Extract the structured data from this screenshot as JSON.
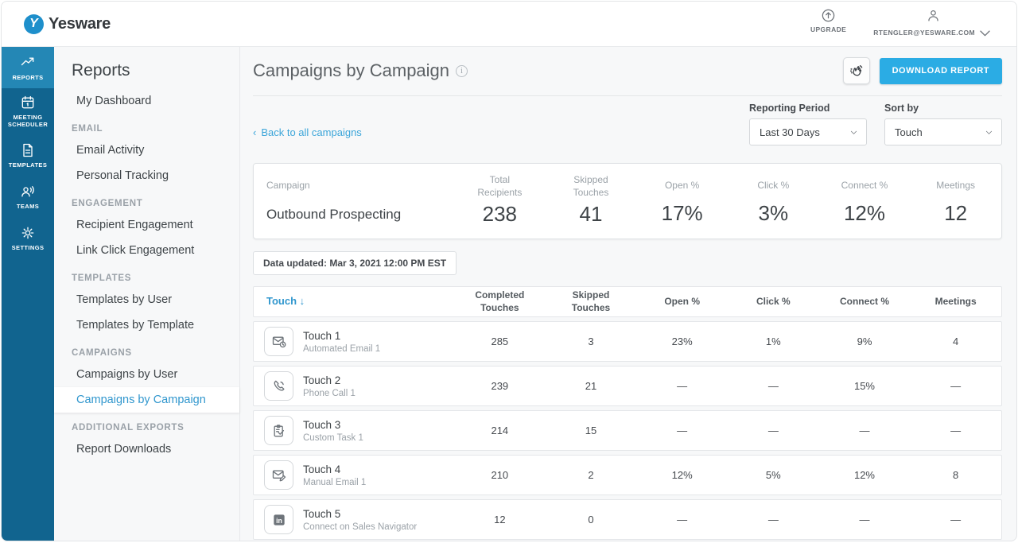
{
  "colors": {
    "accent_blue": "#2bace4",
    "link_blue": "#3ba5d9",
    "rail_blue": "#11648f",
    "rail_active_blue": "#2487b5"
  },
  "topbar": {
    "brand": "Yesware",
    "brand_initial": "Y",
    "upgrade_label": "UPGRADE",
    "account_email": "RTENGLER@YESWARE.COM"
  },
  "rail": {
    "items": [
      {
        "label": "REPORTS"
      },
      {
        "label": "MEETING SCHEDULER"
      },
      {
        "label": "TEMPLATES"
      },
      {
        "label": "TEAMS"
      },
      {
        "label": "SETTINGS"
      }
    ]
  },
  "sidebar": {
    "title": "Reports",
    "entries": [
      {
        "label": "My Dashboard"
      },
      {
        "label": "EMAIL"
      },
      {
        "label": "Email Activity"
      },
      {
        "label": "Personal Tracking"
      },
      {
        "label": "ENGAGEMENT"
      },
      {
        "label": "Recipient Engagement"
      },
      {
        "label": "Link Click Engagement"
      },
      {
        "label": "TEMPLATES"
      },
      {
        "label": "Templates by User"
      },
      {
        "label": "Templates by Template"
      },
      {
        "label": "CAMPAIGNS"
      },
      {
        "label": "Campaigns by User"
      },
      {
        "label": "Campaigns by Campaign"
      },
      {
        "label": "ADDITIONAL EXPORTS"
      },
      {
        "label": "Report Downloads"
      }
    ]
  },
  "main": {
    "title": "Campaigns by Campaign",
    "download_label": "DOWNLOAD REPORT",
    "back_chevron": "‹",
    "back_label": "Back to all campaigns",
    "filters": {
      "reporting_period": {
        "label": "Reporting Period",
        "value": "Last 30 Days"
      },
      "sort_by": {
        "label": "Sort by",
        "value": "Touch"
      }
    },
    "summary": {
      "headers": [
        "Campaign",
        "Total Recipients",
        "Skipped Touches",
        "Open %",
        "Click %",
        "Connect %",
        "Meetings"
      ],
      "campaign_name": "Outbound Prospecting",
      "values": [
        "238",
        "41",
        "17%",
        "3%",
        "12%",
        "12"
      ]
    },
    "data_updated": "Data updated: Mar 3, 2021 12:00 PM EST",
    "table": {
      "sort_label": "Touch",
      "sort_arrow": "↓",
      "headers": [
        "Completed Touches",
        "Skipped Touches",
        "Open %",
        "Click %",
        "Connect %",
        "Meetings"
      ],
      "rows": [
        {
          "icon": "automated-email",
          "title": "Touch 1",
          "subtitle": "Automated Email 1",
          "values": [
            "285",
            "3",
            "23%",
            "1%",
            "9%",
            "4"
          ]
        },
        {
          "icon": "phone-call",
          "title": "Touch 2",
          "subtitle": "Phone Call 1",
          "values": [
            "239",
            "21",
            "—",
            "—",
            "15%",
            "—"
          ]
        },
        {
          "icon": "custom-task",
          "title": "Touch 3",
          "subtitle": "Custom Task 1",
          "values": [
            "214",
            "15",
            "—",
            "—",
            "—",
            "—"
          ]
        },
        {
          "icon": "manual-email",
          "title": "Touch 4",
          "subtitle": "Manual Email 1",
          "values": [
            "210",
            "2",
            "12%",
            "5%",
            "12%",
            "8"
          ]
        },
        {
          "icon": "linkedin",
          "title": "Touch 5",
          "subtitle": "Connect on Sales Navigator",
          "values": [
            "12",
            "0",
            "—",
            "—",
            "—",
            "—"
          ]
        }
      ]
    }
  }
}
